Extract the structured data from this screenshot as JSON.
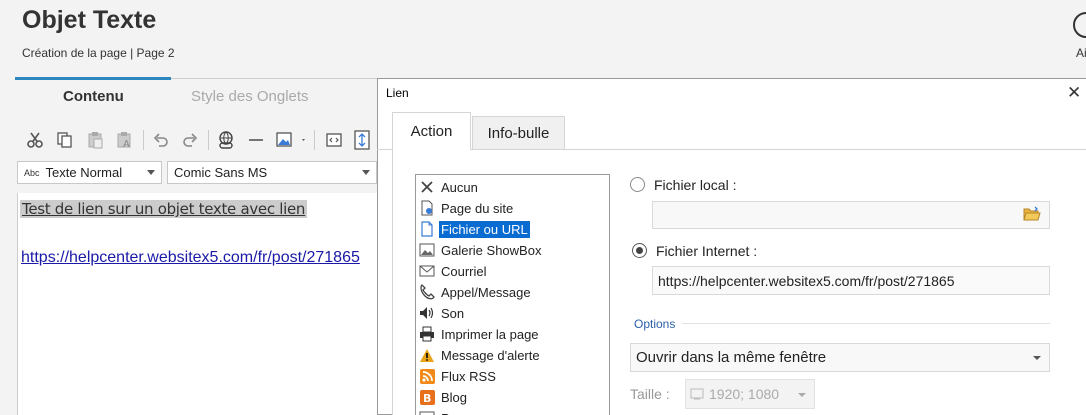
{
  "app": {
    "title": "Objet Texte",
    "subtitle": "Création de la page | Page 2",
    "help_label": "Ai"
  },
  "editor_tabs": [
    {
      "label": "Contenu",
      "active": true
    },
    {
      "label": "Style des Onglets",
      "active": false
    }
  ],
  "toolbar": {
    "icons": [
      "cut-icon",
      "copy-icon",
      "paste-icon",
      "paste-text-icon",
      "undo-icon",
      "redo-icon",
      "link-icon",
      "horizontal-line-icon",
      "image-icon",
      "html-code-icon",
      "line-height-icon"
    ]
  },
  "format": {
    "style_prefix": "Abc",
    "style_value": "Texte Normal",
    "font_value": "Comic Sans MS"
  },
  "editor": {
    "line1": "Test de lien sur un objet texte avec lien",
    "link": "https://helpcenter.websitex5.com/fr/post/271865"
  },
  "dialog": {
    "title": "Lien",
    "close_glyph": "✕",
    "tabs": [
      {
        "label": "Action",
        "active": true
      },
      {
        "label": "Info-bulle",
        "active": false
      }
    ],
    "link_types": [
      {
        "label": "Aucun",
        "icon": "close-x-icon"
      },
      {
        "label": "Page du site",
        "icon": "page-icon"
      },
      {
        "label": "Fichier ou URL",
        "icon": "file-url-icon",
        "selected": true
      },
      {
        "label": "Galerie ShowBox",
        "icon": "gallery-icon"
      },
      {
        "label": "Courriel",
        "icon": "mail-icon"
      },
      {
        "label": "Appel/Message",
        "icon": "phone-icon"
      },
      {
        "label": "Son",
        "icon": "speaker-icon"
      },
      {
        "label": "Imprimer la page",
        "icon": "printer-icon"
      },
      {
        "label": "Message d'alerte",
        "icon": "warning-icon"
      },
      {
        "label": "Flux RSS",
        "icon": "rss-icon"
      },
      {
        "label": "Blog",
        "icon": "blog-icon"
      },
      {
        "label": "P",
        "icon": "more-icon"
      }
    ],
    "local_file": {
      "label": "Fichier local  :",
      "value": "",
      "selected": false
    },
    "internet_file": {
      "label": "Fichier Internet :",
      "value": "https://helpcenter.websitex5.com/fr/post/271865",
      "selected": true
    },
    "options_title": "Options",
    "open_mode": "Ouvrir dans la même fenêtre",
    "size_label": "Taille :",
    "size_value": "1920; 1080"
  },
  "colors": {
    "accent": "#2e86c1",
    "selection": "#0a6bd1",
    "link": "#1a1aa6",
    "options_title": "#2a60a8"
  }
}
